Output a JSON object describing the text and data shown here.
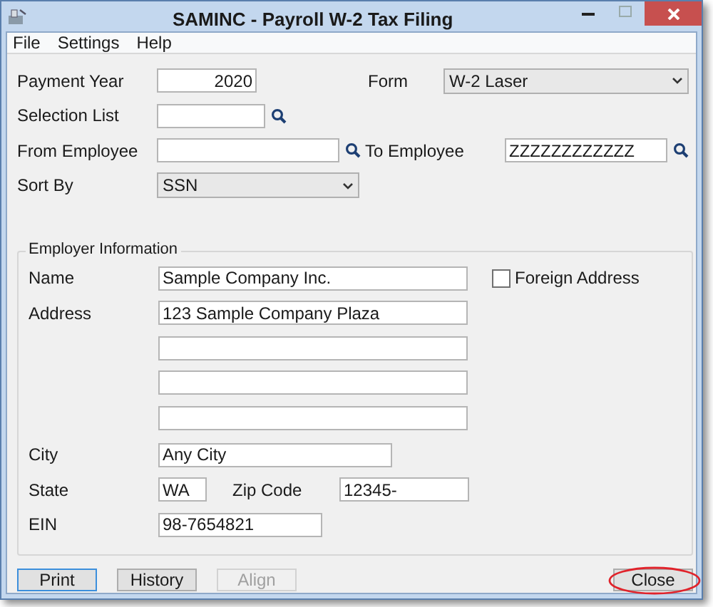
{
  "window": {
    "title": "SAMINC - Payroll W-2 Tax Filing"
  },
  "menu": [
    "File",
    "Settings",
    "Help"
  ],
  "payment_year": {
    "label": "Payment Year",
    "value": "2020"
  },
  "form": {
    "label": "Form",
    "value": "W-2 Laser"
  },
  "selection_list": {
    "label": "Selection List"
  },
  "from_employee": {
    "label": "From Employee"
  },
  "to_employee": {
    "label": "To Employee",
    "value": "ZZZZZZZZZZZZ"
  },
  "sort_by": {
    "label": "Sort By",
    "value": "SSN"
  },
  "employer": {
    "title": "Employer Information",
    "name": {
      "label": "Name",
      "value": "Sample Company Inc."
    },
    "foreign_address": {
      "label": "Foreign Address",
      "checked": false
    },
    "address": {
      "label": "Address",
      "value": "123 Sample Company Plaza"
    },
    "city": {
      "label": "City",
      "value": "Any City"
    },
    "state": {
      "label": "State",
      "value": "WA"
    },
    "zip_code": {
      "label": "Zip Code",
      "value": "12345-"
    },
    "ein": {
      "label": "EIN",
      "value": "98-7654821"
    }
  },
  "buttons": [
    {
      "label": "Print",
      "disabled": false,
      "focused": true,
      "highlighted": false
    },
    {
      "label": "History",
      "disabled": false,
      "focused": false,
      "highlighted": false
    },
    {
      "label": "Align",
      "disabled": true,
      "focused": false,
      "highlighted": false
    },
    {
      "label": "Close",
      "disabled": false,
      "focused": false,
      "highlighted": true
    }
  ]
}
